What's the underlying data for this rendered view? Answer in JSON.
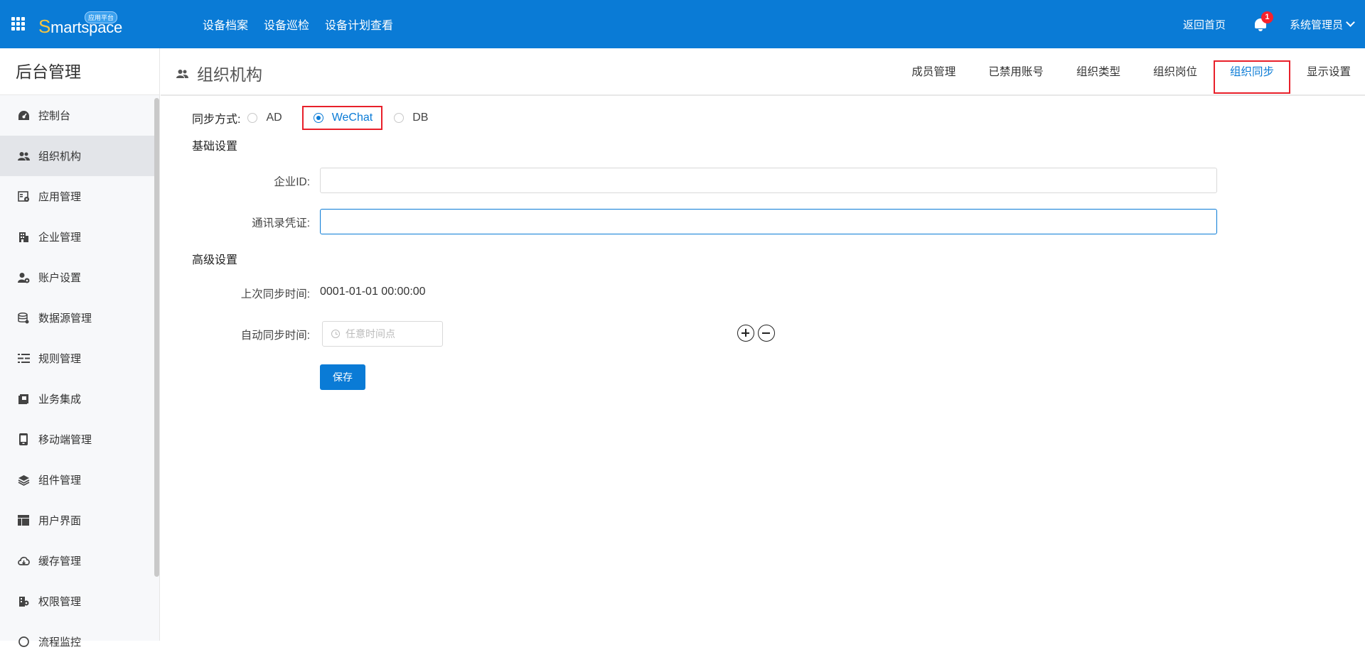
{
  "header": {
    "logo_text_first": "S",
    "logo_text_rest": "martspace",
    "logo_badge": "应用平台",
    "nav": [
      "设备档案",
      "设备巡检",
      "设备计划查看"
    ],
    "home_link": "返回首页",
    "notification_count": "1",
    "user_name": "系统管理员"
  },
  "sidebar": {
    "title": "后台管理",
    "items": [
      {
        "label": "控制台",
        "icon": "dashboard-icon"
      },
      {
        "label": "组织机构",
        "icon": "users-icon"
      },
      {
        "label": "应用管理",
        "icon": "app-manage-icon"
      },
      {
        "label": "企业管理",
        "icon": "building-icon"
      },
      {
        "label": "账户设置",
        "icon": "account-icon"
      },
      {
        "label": "数据源管理",
        "icon": "database-icon"
      },
      {
        "label": "规则管理",
        "icon": "rules-icon"
      },
      {
        "label": "业务集成",
        "icon": "integration-icon"
      },
      {
        "label": "移动端管理",
        "icon": "mobile-icon"
      },
      {
        "label": "组件管理",
        "icon": "layers-icon"
      },
      {
        "label": "用户界面",
        "icon": "layout-icon"
      },
      {
        "label": "缓存管理",
        "icon": "cache-icon"
      },
      {
        "label": "权限管理",
        "icon": "permission-icon"
      },
      {
        "label": "流程监控",
        "icon": "flow-icon"
      }
    ],
    "active_index": 1
  },
  "page": {
    "title": "组织机构",
    "tabs": [
      "成员管理",
      "已禁用账号",
      "组织类型",
      "组织岗位",
      "组织同步",
      "显示设置"
    ],
    "active_tab": "组织同步"
  },
  "form": {
    "sync_label": "同步方式:",
    "sync_options": [
      "AD",
      "WeChat",
      "DB"
    ],
    "sync_selected": "WeChat",
    "basic_section": "基础设置",
    "corp_id_label": "企业ID:",
    "corp_id_value": "",
    "contact_secret_label": "通讯录凭证:",
    "contact_secret_value": "",
    "advanced_section": "高级设置",
    "last_sync_label": "上次同步时间:",
    "last_sync_value": "0001-01-01 00:00:00",
    "auto_sync_label": "自动同步时间:",
    "auto_sync_placeholder": "任意时间点",
    "save_label": "保存"
  },
  "colors": {
    "brand": "#0a7bd6",
    "highlight_box": "#e8202a",
    "badge": "#f5222d"
  }
}
